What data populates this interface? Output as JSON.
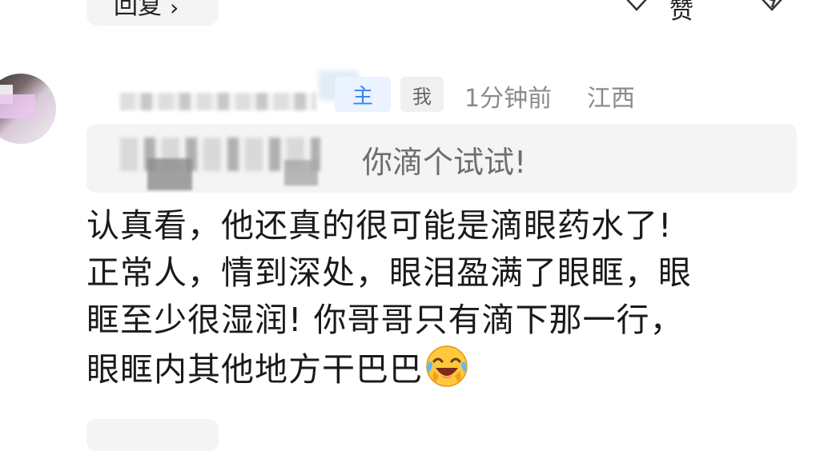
{
  "actions": {
    "reply_label": "回复",
    "reply_chevron": "›",
    "like_label": "赞"
  },
  "comment": {
    "badges": {
      "author": "主",
      "me": "我"
    },
    "time": "1分钟前",
    "location": "江西",
    "quote": {
      "text": "你滴个试试!"
    },
    "body_lines": [
      "认真看，他还真的很可能是滴眼药水了!",
      "正常人，情到深处，眼泪盈满了眼眶，眼",
      "眶至少很湿润! 你哥哥只有滴下那一行，",
      "眼眶内其他地方干巴巴"
    ],
    "emoji": "laughing-crying-emoji"
  },
  "colors": {
    "author_badge": "#3b82f6",
    "meta_gray": "#8a8a8a",
    "quote_bg": "#f4f4f5"
  }
}
